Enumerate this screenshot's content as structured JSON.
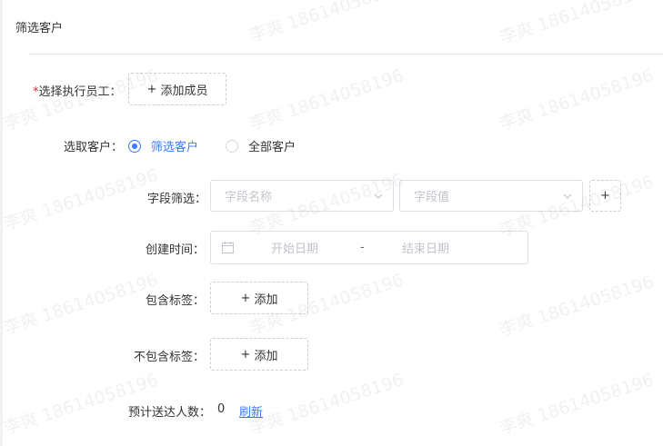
{
  "header": {
    "title": "筛选客户"
  },
  "form": {
    "staff": {
      "required_mark": "*",
      "label": "选择执行员工：",
      "add_button": {
        "icon": "+",
        "label": "添加成员"
      }
    },
    "customer_scope": {
      "label": "选取客户：",
      "options": [
        {
          "label": "筛选客户",
          "checked": true
        },
        {
          "label": "全部客户",
          "checked": false
        }
      ]
    },
    "field_filter": {
      "label": "字段筛选：",
      "name_placeholder": "字段名称",
      "value_placeholder": "字段值",
      "add_icon": "+"
    },
    "created_time": {
      "label": "创建时间：",
      "start_placeholder": "开始日期",
      "separator": "-",
      "end_placeholder": "结束日期"
    },
    "include_tags": {
      "label": "包含标签：",
      "button_icon": "+",
      "button_label": "添加"
    },
    "exclude_tags": {
      "label": "不包含标签：",
      "button_icon": "+",
      "button_label": "添加"
    },
    "estimate": {
      "label": "预计送达人数：",
      "value": "0",
      "refresh_label": "刷新"
    }
  },
  "watermark": {
    "text": "李爽 18614058196"
  },
  "colors": {
    "accent": "#3a7afe",
    "required": "#f5222d",
    "placeholder": "#c0c4cc",
    "border": "#dcdfe6"
  }
}
